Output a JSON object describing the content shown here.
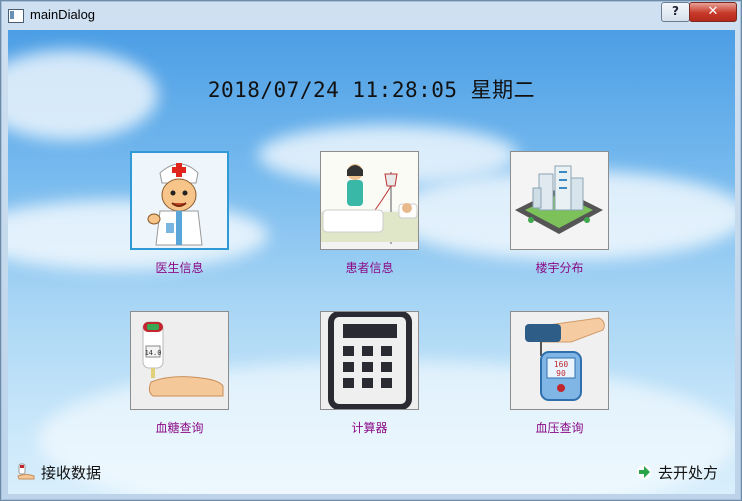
{
  "window": {
    "title": "mainDialog",
    "help_label": "?",
    "close_label": "✕"
  },
  "datetime": "2018/07/24  11:28:05  星期二",
  "tiles": [
    {
      "label": "医生信息",
      "icon": "doctor-icon"
    },
    {
      "label": "患者信息",
      "icon": "patient-bed-icon"
    },
    {
      "label": "楼宇分布",
      "icon": "buildings-icon"
    },
    {
      "label": "血糖查询",
      "icon": "glucose-meter-icon"
    },
    {
      "label": "计算器",
      "icon": "calculator-icon"
    },
    {
      "label": "血压查询",
      "icon": "blood-pressure-monitor-icon"
    }
  ],
  "bottom": {
    "receive_label": "接收数据",
    "prescribe_label": "去开处方"
  },
  "colors": {
    "tile_label": "#8b0b87",
    "selected_border": "#2f9ad6",
    "arrow_green": "#2aa54a"
  },
  "bp_readout": {
    "systolic": "160",
    "diastolic": "90"
  },
  "glucose_readout": "14.0"
}
